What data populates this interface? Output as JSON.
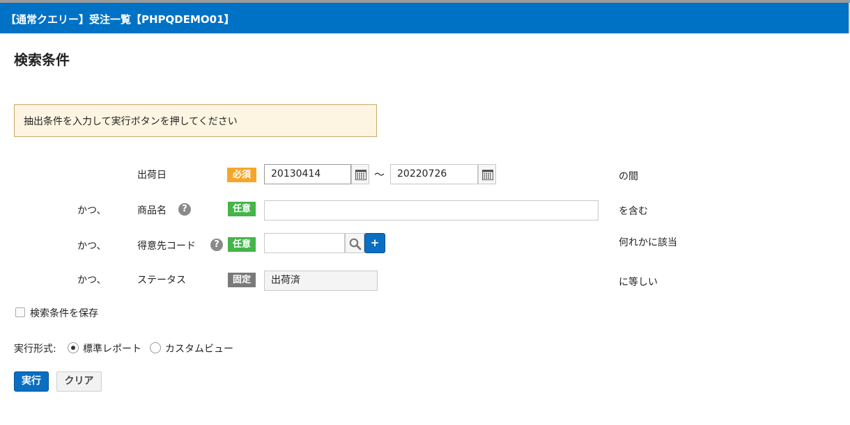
{
  "header": {
    "title": "【通常クエリー】受注一覧【PHPQDEMO01】"
  },
  "section_title": "検索条件",
  "notice": "抽出条件を入力して実行ボタンを押してください",
  "conditions": [
    {
      "conj": "",
      "label": "出荷日",
      "badge": "必須",
      "from": "20130414",
      "tilde": "～",
      "to": "20220726",
      "op": "の間"
    },
    {
      "conj": "かつ、",
      "label": "商品名",
      "badge": "任意",
      "value": "",
      "op": "を含む"
    },
    {
      "conj": "かつ、",
      "label": "得意先コード",
      "badge": "任意",
      "value": "",
      "plus": "+",
      "op": "何れかに該当"
    },
    {
      "conj": "かつ、",
      "label": "ステータス",
      "badge": "固定",
      "value": "出荷済",
      "op": "に等しい"
    }
  ],
  "help_glyph": "?",
  "save_label": "検索条件を保存",
  "exec_format": {
    "label": "実行形式:",
    "options": [
      "標準レポート",
      "カスタムビュー"
    ],
    "selected": "標準レポート"
  },
  "buttons": {
    "run": "実行",
    "clear": "クリア"
  },
  "colors": {
    "header_bg": "#0072c6",
    "required": "#f5a62a",
    "optional": "#43b549",
    "fixed": "#7a7a7a",
    "primary": "#0a6fc2"
  }
}
